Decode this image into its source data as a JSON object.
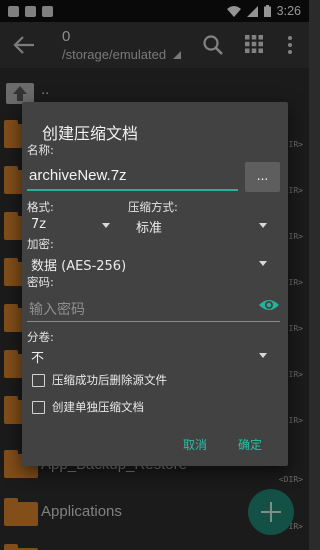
{
  "status_bar": {
    "time": "3:26"
  },
  "toolbar": {
    "item_count": "0",
    "path": "/storage/emulated"
  },
  "file_list": {
    "parent_label": "..",
    "dir_tag": "<DIR>",
    "items": [
      "App_Backup_Restore",
      "Applications"
    ]
  },
  "dialog": {
    "title": "创建压缩文档",
    "name_label": "名称:",
    "name_value": "archiveNew.7z",
    "browse_label": "...",
    "format_label": "格式:",
    "format_value": "7z",
    "compression_label": "压缩方式:",
    "compression_value": "标准",
    "encryption_label": "加密:",
    "encryption_value": "数据 (AES-256)",
    "password_label": "密码:",
    "password_placeholder": "输入密码",
    "split_label": "分卷:",
    "split_value": "不",
    "delete_source_label": "压缩成功后删除源文件",
    "separate_archives_label": "创建单独压缩文档",
    "cancel_label": "取消",
    "ok_label": "确定"
  },
  "colors": {
    "accent": "#2bbfa8",
    "folder": "#e0872e",
    "fab": "#228a78"
  },
  "icons": [
    "back-arrow-icon",
    "search-icon",
    "grid-icon",
    "more-icon",
    "folder-up-icon",
    "folder-icon",
    "eye-icon",
    "add-icon"
  ]
}
